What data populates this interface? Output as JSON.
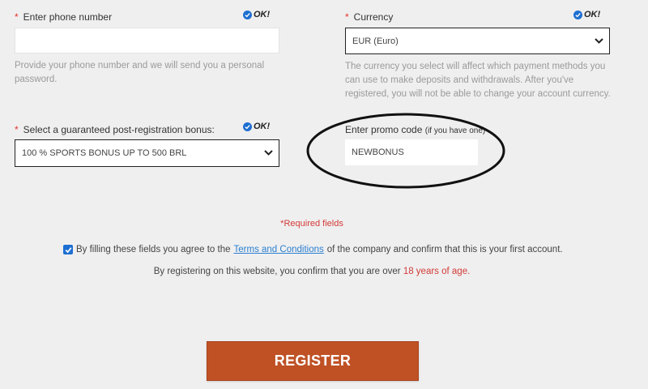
{
  "phone": {
    "required_mark": "*",
    "label": "Enter phone number",
    "ok_text": "OK!",
    "value": "",
    "hint": "Provide your phone number and we will send you a personal password."
  },
  "currency": {
    "required_mark": "*",
    "label": "Currency",
    "ok_text": "OK!",
    "selected": "EUR (Euro)",
    "hint": "The currency you select will affect which payment methods you can use to make deposits and withdrawals. After you've registered, you will not be able to change your account currency."
  },
  "bonus": {
    "required_mark": "*",
    "label": "Select a guaranteed post-registration bonus:",
    "ok_text": "OK!",
    "selected": "100 % SPORTS BONUS UP TO 500 BRL"
  },
  "promo": {
    "label": "Enter promo code",
    "label_small": "(if you have one)",
    "value": "NEWBONUS"
  },
  "required_note": "*Required fields",
  "agreement": {
    "checked": true,
    "text_before": "By filling these fields you agree to the",
    "link_text": "Terms and Conditions",
    "text_after": "of the company and confirm that this is your first account."
  },
  "age_notice": {
    "text_before": "By registering on this website, you confirm that you are over",
    "highlight": "18 years of age."
  },
  "register_label": "REGISTER",
  "colors": {
    "background": "#efeff0",
    "required_red": "#e4322b",
    "check_blue": "#1e6fd1",
    "link_blue": "#2b7fcf",
    "register_orange": "#bf5125"
  },
  "icons": {
    "ok": "check-circle-icon",
    "dropdown": "chevron-down-icon",
    "checkbox": "checkbox-checked-icon"
  }
}
